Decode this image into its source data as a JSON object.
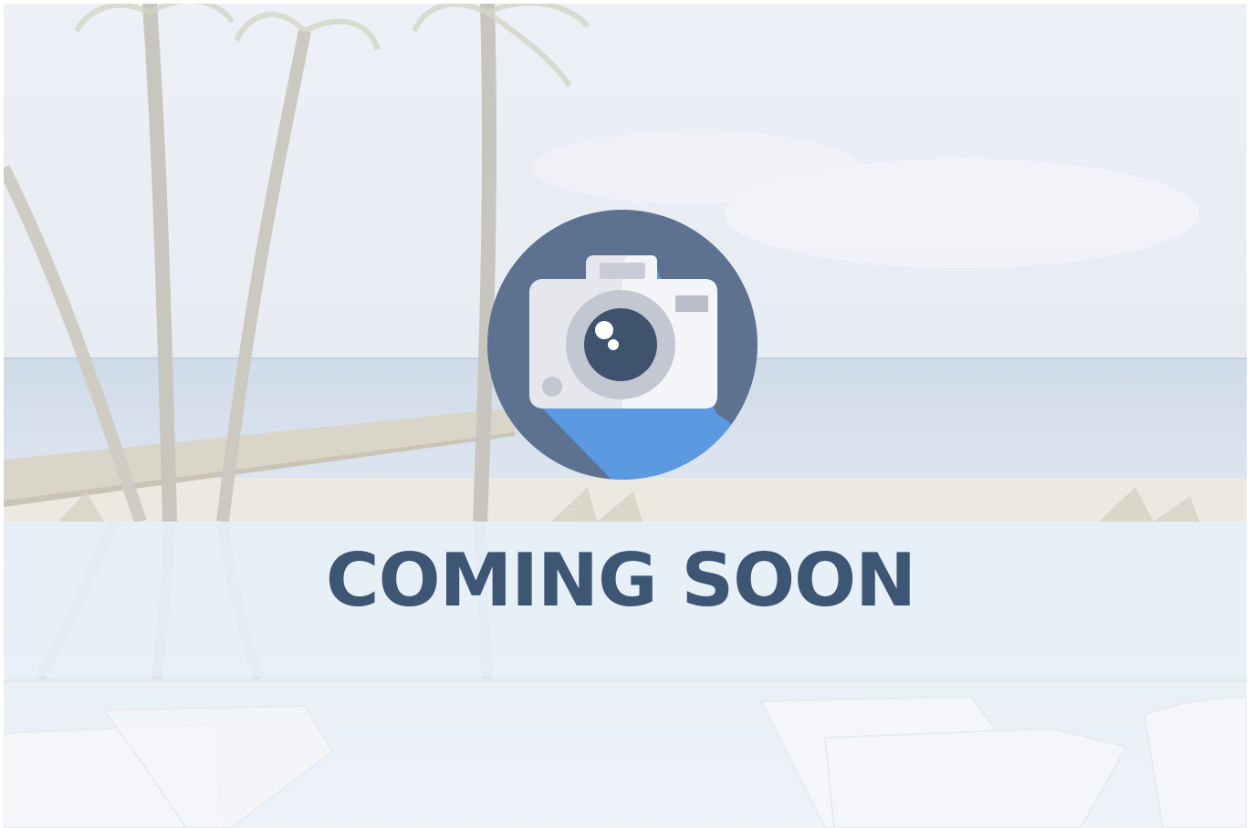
{
  "title": "COMING SOON",
  "icons": {
    "badge": "camera-icon",
    "background": "beach-photo"
  },
  "colors": {
    "badge_circle": "#5c7290",
    "badge_shadow": "#5b9ae0",
    "title_text": "#3d5674",
    "lens_dark": "#3f536f"
  }
}
